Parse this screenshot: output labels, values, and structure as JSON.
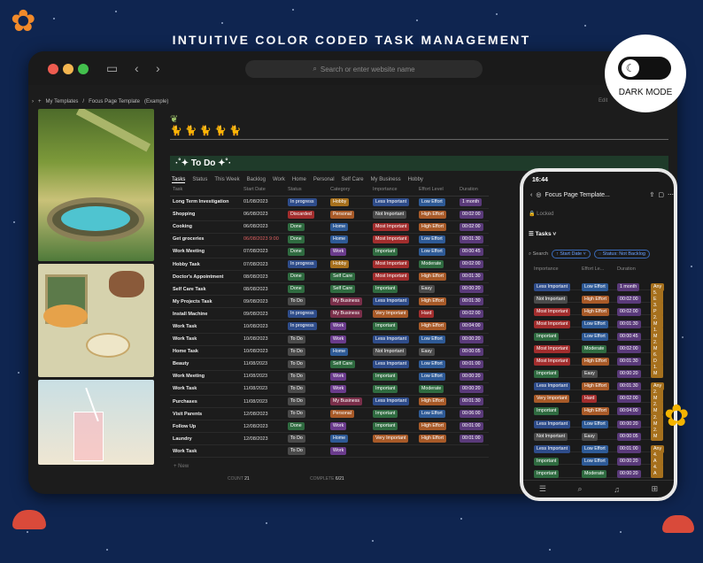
{
  "banner": "INTUITIVE COLOR CODED TASK MANAGEMENT",
  "browser": {
    "url_placeholder": "Search or enter website name"
  },
  "breadcrumb": [
    "My Templates",
    "/",
    "Focus Page Template",
    "(Example)"
  ],
  "header": {
    "title": "·˚✦ To Do ✦˚·",
    "edit": "Edit"
  },
  "tabs": [
    "Tasks",
    "Status",
    "This Week",
    "Backlog",
    "Work",
    "Home",
    "Personal",
    "Self Care",
    "My Business",
    "Hobby"
  ],
  "columns": [
    "Task",
    "Start Date",
    "Status",
    "Category",
    "Importance",
    "Effort Level",
    "Duration"
  ],
  "rows": [
    {
      "task": "Long Term Investigation",
      "date": "01/08/2023",
      "status": "In progress",
      "category": "Hobby",
      "importance": "Less Important",
      "effort": "Low Effort",
      "duration": "1 month"
    },
    {
      "task": "Shopping",
      "date": "06/08/2023",
      "status": "Discarded",
      "category": "Personal",
      "importance": "Not Important",
      "effort": "High Effort",
      "duration": "00:02:00"
    },
    {
      "task": "Cooking",
      "date": "06/08/2023",
      "status": "Done",
      "category": "Home",
      "importance": "Most Important",
      "effort": "High Effort",
      "duration": "00:02:00"
    },
    {
      "task": "Get groceries",
      "date": "06/08/2023 9:00",
      "status": "Done",
      "category": "Home",
      "importance": "Most Important",
      "effort": "Low Effort",
      "duration": "00:01:30"
    },
    {
      "task": "Work Meeting",
      "date": "07/08/2023",
      "status": "Done",
      "category": "Work",
      "importance": "Important",
      "effort": "Low Effort",
      "duration": "00:00:45"
    },
    {
      "task": "Hobby Task",
      "date": "07/08/2023",
      "status": "In progress",
      "category": "Hobby",
      "importance": "Most Important",
      "effort": "Moderate",
      "duration": "00:02:00"
    },
    {
      "task": "Doctor's Appointment",
      "date": "08/08/2023",
      "status": "Done",
      "category": "Self Care",
      "importance": "Most Important",
      "effort": "High Effort",
      "duration": "00:01:30"
    },
    {
      "task": "Self Care Task",
      "date": "08/08/2023",
      "status": "Done",
      "category": "Self Care",
      "importance": "Important",
      "effort": "Easy",
      "duration": "00:00:20"
    },
    {
      "task": "My Projects Task",
      "date": "09/08/2023",
      "status": "To Do",
      "category": "My Business",
      "importance": "Less Important",
      "effort": "High Effort",
      "duration": "00:01:30"
    },
    {
      "task": "Install Machine",
      "date": "09/08/2023",
      "status": "In progress",
      "category": "My Business",
      "importance": "Very Important",
      "effort": "Hard",
      "duration": "00:02:00"
    },
    {
      "task": "Work Task",
      "date": "10/08/2023",
      "status": "In progress",
      "category": "Work",
      "importance": "Important",
      "effort": "High Effort",
      "duration": "00:04:00"
    },
    {
      "task": "Work Task",
      "date": "10/08/2023",
      "status": "To Do",
      "category": "Work",
      "importance": "Less Important",
      "effort": "Low Effort",
      "duration": "00:00:20"
    },
    {
      "task": "Home Task",
      "date": "10/08/2023",
      "status": "To Do",
      "category": "Home",
      "importance": "Not Important",
      "effort": "Easy",
      "duration": "00:00:05"
    },
    {
      "task": "Beauty",
      "date": "11/08/2023",
      "status": "To Do",
      "category": "Self Care",
      "importance": "Less Important",
      "effort": "Low Effort",
      "duration": "00:01:00"
    },
    {
      "task": "Work Meeting",
      "date": "11/08/2023",
      "status": "To Do",
      "category": "Work",
      "importance": "Important",
      "effort": "Low Effort",
      "duration": "00:00:20"
    },
    {
      "task": "Work Task",
      "date": "11/08/2023",
      "status": "To Do",
      "category": "Work",
      "importance": "Important",
      "effort": "Moderate",
      "duration": "00:00:20"
    },
    {
      "task": "Purchases",
      "date": "11/08/2023",
      "status": "To Do",
      "category": "My Business",
      "importance": "Less Important",
      "effort": "High Effort",
      "duration": "00:01:30"
    },
    {
      "task": "Visit Parents",
      "date": "12/08/2023",
      "status": "To Do",
      "category": "Personal",
      "importance": "Important",
      "effort": "Low Effort",
      "duration": "00:06:00"
    },
    {
      "task": "Follow Up",
      "date": "12/08/2023",
      "status": "Done",
      "category": "Work",
      "importance": "Important",
      "effort": "High Effort",
      "duration": "00:01:00"
    },
    {
      "task": "Laundry",
      "date": "12/08/2023",
      "status": "To Do",
      "category": "Home",
      "importance": "Very Important",
      "effort": "High Effort",
      "duration": "00:01:00"
    },
    {
      "task": "Work Task",
      "date": "",
      "status": "To Do",
      "category": "Work",
      "importance": "",
      "effort": "",
      "duration": ""
    }
  ],
  "new_label": "+ New",
  "footer": {
    "count_label": "COUNT",
    "count": "21",
    "complete_label": "COMPLETE",
    "complete": "6/21"
  },
  "darkmode": {
    "label": "DARK MODE"
  },
  "phone": {
    "time": "16:44",
    "title": "Focus Page Template...",
    "locked": "Locked",
    "view": "Tasks",
    "search": "Search",
    "filter1": "Start Date",
    "filter2": "Status: Not Backlog",
    "columns": [
      "Importance",
      "Effort Le...",
      "Duration"
    ],
    "rows": [
      [
        "Less Important",
        "Low Effort",
        "1 month",
        "Any"
      ],
      [
        "Not Important",
        "High Effort",
        "00:02:00",
        "5. E"
      ],
      [
        "Most Important",
        "High Effort",
        "00:02:00",
        "3. P"
      ],
      [
        "Most Important",
        "Low Effort",
        "00:01:30",
        "2. M"
      ],
      [
        "Important",
        "Low Effort",
        "00:00:45",
        "1. M"
      ],
      [
        "Most Important",
        "Moderate",
        "00:02:00",
        "2. M"
      ],
      [
        "Most Important",
        "High Effort",
        "00:01:30",
        "6. D"
      ],
      [
        "Important",
        "Easy",
        "00:00:20",
        "1. M"
      ],
      [
        "Less Important",
        "High Effort",
        "00:01:30",
        "Any"
      ],
      [
        "Very Important",
        "Hard",
        "00:02:00",
        "2. M"
      ],
      [
        "Important",
        "High Effort",
        "00:04:00",
        "2. M"
      ],
      [
        "Less Important",
        "Low Effort",
        "00:00:20",
        "2. M"
      ],
      [
        "Not Important",
        "Easy",
        "00:00:05",
        "2. M"
      ],
      [
        "Less Important",
        "Low Effort",
        "00:01:00",
        "Any"
      ],
      [
        "Important",
        "Low Effort",
        "00:00:20",
        "4. A"
      ],
      [
        "Important",
        "Moderate",
        "00:00:20",
        "4. A"
      ]
    ]
  },
  "colors": {
    "In progress": "#2e4c8a",
    "Discarded": "#a22d2d",
    "Done": "#2f6b40",
    "To Do": "#4a4a4a",
    "Hobby": "#a6701d",
    "Personal": "#a85a28",
    "Home": "#2e5a96",
    "Work": "#6a3b8c",
    "Self Care": "#2f6b40",
    "My Business": "#7a2f4a",
    "Less Important": "#2e4c8a",
    "Not Important": "#4a4a4a",
    "Most Important": "#a22d2d",
    "Important": "#2f6b40",
    "Very Important": "#a85a28",
    "Low Effort": "#2e5a96",
    "High Effort": "#a85a28",
    "Moderate": "#2f6b40",
    "Easy": "#4a4a4a",
    "Hard": "#a22d2d",
    "duration": "#5a3a7a"
  }
}
